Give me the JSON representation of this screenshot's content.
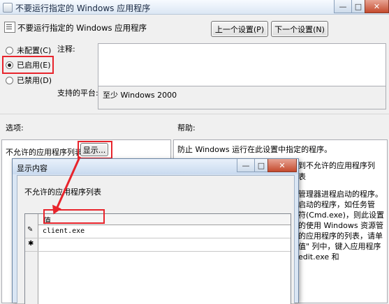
{
  "window": {
    "title": "不要运行指定的 Windows 应用程序",
    "min_glyph": "—",
    "max_glyph": "□",
    "close_glyph": "✕"
  },
  "policy": {
    "title": "不要运行指定的 Windows 应用程序",
    "prev_button": "上一个设置(P)",
    "next_button": "下一个设置(N)"
  },
  "options": {
    "not_configured": "未配置(C)",
    "enabled": "已启用(E)",
    "disabled": "已禁用(D)",
    "selected": "enabled"
  },
  "comment": {
    "label": "注释:",
    "value": ""
  },
  "platform": {
    "label": "支持的平台:",
    "value": "至少 Windows 2000"
  },
  "sections": {
    "options_label": "选项:",
    "help_label": "帮助:"
  },
  "options_panel": {
    "list_label": "不允许的应用程序列表",
    "show_button": "显示..."
  },
  "help_panel": {
    "lines": [
      "防止 Windows 运行在此设置中指定的程序。",
      "到不允许的应用程序列",
      "表",
      "管理器进程启动的程序。",
      "启动的程序，如任务管",
      "符(Cmd.exe)，则此设置",
      "的使用 Windows 资源管",
      "的应用程序的列表，请单",
      "值\" 列中，键入应用程序",
      "edit.exe 和"
    ]
  },
  "dialog": {
    "title": "显示内容",
    "list_label": "不允许的应用程序列表",
    "column_header": "值",
    "rows": [
      {
        "marker": "✎",
        "value": "client.exe"
      },
      {
        "marker": "✱",
        "value": ""
      }
    ],
    "min_glyph": "—",
    "max_glyph": "□",
    "close_glyph": "✕"
  },
  "colors": {
    "highlight": "#e8242c",
    "window_bg": "#f0f0f0",
    "dialog_frame": "#dae6f4"
  }
}
